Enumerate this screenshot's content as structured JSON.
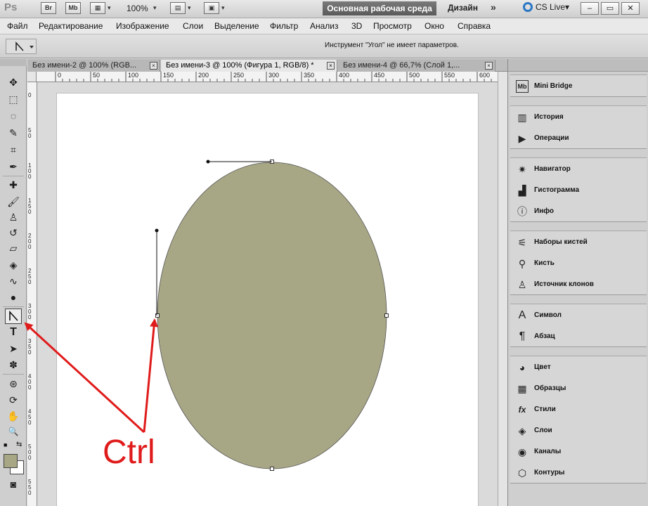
{
  "app": {
    "logo": "Ps",
    "bridge": "Br",
    "minibridge": "Mb",
    "zoom": "100%",
    "workspace": "Основная рабочая среда",
    "design": "Дизайн",
    "more": "»",
    "cs_live": "CS Live",
    "dropdown": "▾"
  },
  "window_controls": {
    "minimize": "–",
    "maximize": "▭",
    "close": "✕"
  },
  "menu": [
    "Файл",
    "Редактирование",
    "Изображение",
    "Слои",
    "Выделение",
    "Фильтр",
    "Анализ",
    "3D",
    "Просмотр",
    "Окно",
    "Справка"
  ],
  "options": {
    "hint": "Инструмент \"Угол\" не имеет параметров."
  },
  "tabs": [
    {
      "label": "Без имени-2 @ 100% (RGB...",
      "close": "×"
    },
    {
      "label": "Без имени-3 @ 100% (Фигура 1, RGB/8) *",
      "close": "×"
    },
    {
      "label": "Без имени-4 @ 66,7% (Слой 1,...",
      "close": "×"
    }
  ],
  "ruler": {
    "h_labels": [
      "0",
      "50",
      "100",
      "150",
      "200",
      "250",
      "300",
      "350",
      "400",
      "450",
      "500",
      "550",
      "600"
    ],
    "v_labels": [
      "0",
      "50",
      "100",
      "150",
      "200",
      "250",
      "300",
      "350",
      "400",
      "450",
      "500",
      "550"
    ]
  },
  "colors": {
    "foreground": "#a7a685",
    "background": "#ffffff",
    "ellipse": "#a7a685",
    "annotation": "#e01b1b",
    "workspace_button": "#646464"
  },
  "tools": [
    {
      "name": "move-tool-icon",
      "glyph": "✥"
    },
    {
      "name": "marquee-tool-icon",
      "glyph": "⬚"
    },
    {
      "name": "lasso-tool-icon",
      "glyph": "◌"
    },
    {
      "name": "quick-select-tool-icon",
      "glyph": "✎"
    },
    {
      "name": "crop-tool-icon",
      "glyph": "⌗"
    },
    {
      "name": "eyedropper-tool-icon",
      "glyph": "✒"
    },
    {
      "name": "healing-brush-tool-icon",
      "glyph": "✚"
    },
    {
      "name": "brush-tool-icon",
      "glyph": "🖌"
    },
    {
      "name": "clone-stamp-tool-icon",
      "glyph": "♙"
    },
    {
      "name": "history-brush-tool-icon",
      "glyph": "↺"
    },
    {
      "name": "eraser-tool-icon",
      "glyph": "▱"
    },
    {
      "name": "paint-bucket-tool-icon",
      "glyph": "◈"
    },
    {
      "name": "blur-tool-icon",
      "glyph": "∿"
    },
    {
      "name": "dodge-tool-icon",
      "glyph": "●"
    },
    {
      "name": "pen-tool-icon",
      "glyph": "⌐"
    },
    {
      "name": "type-tool-icon",
      "glyph": "T"
    },
    {
      "name": "path-select-tool-icon",
      "glyph": "➤"
    },
    {
      "name": "custom-shape-tool-icon",
      "glyph": "✽"
    },
    {
      "name": "3d-rotate-tool-icon",
      "glyph": "⊛"
    },
    {
      "name": "3d-orbit-tool-icon",
      "glyph": "⟳"
    },
    {
      "name": "hand-tool-icon",
      "glyph": "✋"
    },
    {
      "name": "zoom-tool-icon",
      "glyph": "🔍"
    },
    {
      "name": "quick-mask-icon",
      "glyph": "◙"
    }
  ],
  "panels": [
    [
      {
        "name": "mini-bridge",
        "icon": "mini-bridge-icon",
        "glyph": "Mb",
        "label": "Mini Bridge"
      }
    ],
    [
      {
        "name": "history",
        "icon": "history-icon",
        "glyph": "▥",
        "label": "История"
      },
      {
        "name": "actions",
        "icon": "actions-icon",
        "glyph": "▶",
        "label": "Операции"
      }
    ],
    [
      {
        "name": "navigator",
        "icon": "navigator-icon",
        "glyph": "✷",
        "label": "Навигатор"
      },
      {
        "name": "histogram",
        "icon": "histogram-icon",
        "glyph": "▟",
        "label": "Гистограмма"
      },
      {
        "name": "info",
        "icon": "info-icon",
        "glyph": "ⓘ",
        "label": "Инфо"
      }
    ],
    [
      {
        "name": "brush-presets",
        "icon": "brush-presets-icon",
        "glyph": "⚟",
        "label": "Наборы кистей"
      },
      {
        "name": "brush",
        "icon": "brush-icon",
        "glyph": "⚲",
        "label": "Кисть"
      },
      {
        "name": "clone-source",
        "icon": "clone-source-icon",
        "glyph": "♙",
        "label": "Источник клонов"
      }
    ],
    [
      {
        "name": "character",
        "icon": "character-icon",
        "glyph": "A",
        "label": "Символ"
      },
      {
        "name": "paragraph",
        "icon": "paragraph-icon",
        "glyph": "¶",
        "label": "Абзац"
      }
    ],
    [
      {
        "name": "color",
        "icon": "color-icon",
        "glyph": "◕",
        "label": "Цвет"
      },
      {
        "name": "swatches",
        "icon": "swatches-icon",
        "glyph": "▦",
        "label": "Образцы"
      },
      {
        "name": "styles",
        "icon": "styles-icon",
        "glyph": "fx",
        "label": "Стили"
      },
      {
        "name": "layers",
        "icon": "layers-icon",
        "glyph": "◈",
        "label": "Слои"
      },
      {
        "name": "channels",
        "icon": "channels-icon",
        "glyph": "◉",
        "label": "Каналы"
      },
      {
        "name": "paths",
        "icon": "paths-icon",
        "glyph": "⬡",
        "label": "Контуры"
      }
    ]
  ],
  "annotation": {
    "text": "Ctrl"
  }
}
